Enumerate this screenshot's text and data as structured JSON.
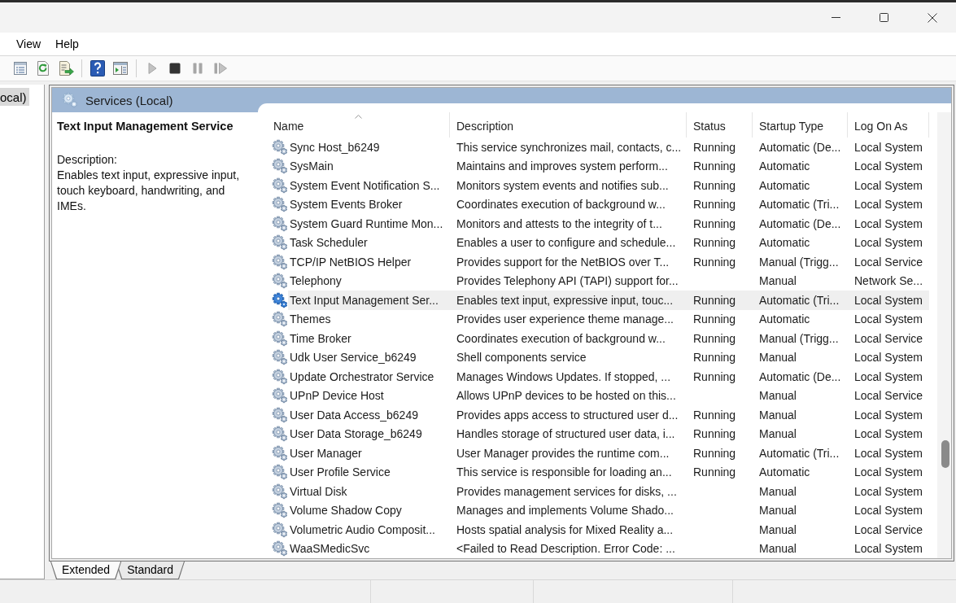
{
  "menu_bar": [
    {
      "label": "View"
    },
    {
      "label": "Help"
    }
  ],
  "toolbar": {
    "groups": [
      [
        {
          "kind": "properties",
          "disabled": false
        },
        {
          "kind": "refresh",
          "disabled": false
        },
        {
          "kind": "export",
          "disabled": false
        }
      ],
      [
        {
          "kind": "help",
          "disabled": false
        },
        {
          "kind": "console_tree",
          "disabled": false
        }
      ],
      [
        {
          "kind": "start",
          "disabled": true
        },
        {
          "kind": "stop",
          "disabled": false
        },
        {
          "kind": "pause",
          "disabled": true
        },
        {
          "kind": "restart",
          "disabled": true
        }
      ]
    ]
  },
  "tree": {
    "items": [
      {
        "label": "ocal)",
        "selected": true
      }
    ]
  },
  "panel": {
    "title": "Services (Local)"
  },
  "details": {
    "title": "Text Input Management Service",
    "description_label": "Description:",
    "description": "Enables text input, expressive input, touch keyboard, handwriting, and IMEs."
  },
  "table": {
    "columns": [
      {
        "label": "Name",
        "sorted": true
      },
      {
        "label": "Description",
        "sorted": false
      },
      {
        "label": "Status",
        "sorted": false
      },
      {
        "label": "Startup Type",
        "sorted": false
      },
      {
        "label": "Log On As",
        "sorted": false
      }
    ],
    "rows": [
      {
        "name": "Sync Host_b6249",
        "description": "This service synchronizes mail, contacts, c...",
        "status": "Running",
        "startup_type": "Automatic (De...",
        "log_on_as": "Local System",
        "selected": false
      },
      {
        "name": "SysMain",
        "description": "Maintains and improves system perform...",
        "status": "Running",
        "startup_type": "Automatic",
        "log_on_as": "Local System",
        "selected": false
      },
      {
        "name": "System Event Notification S...",
        "description": "Monitors system events and notifies sub...",
        "status": "Running",
        "startup_type": "Automatic",
        "log_on_as": "Local System",
        "selected": false
      },
      {
        "name": "System Events Broker",
        "description": "Coordinates execution of background w...",
        "status": "Running",
        "startup_type": "Automatic (Tri...",
        "log_on_as": "Local System",
        "selected": false
      },
      {
        "name": "System Guard Runtime Mon...",
        "description": "Monitors and attests to the integrity of t...",
        "status": "Running",
        "startup_type": "Automatic (De...",
        "log_on_as": "Local System",
        "selected": false
      },
      {
        "name": "Task Scheduler",
        "description": "Enables a user to configure and schedule...",
        "status": "Running",
        "startup_type": "Automatic",
        "log_on_as": "Local System",
        "selected": false
      },
      {
        "name": "TCP/IP NetBIOS Helper",
        "description": "Provides support for the NetBIOS over T...",
        "status": "Running",
        "startup_type": "Manual (Trigg...",
        "log_on_as": "Local Service",
        "selected": false
      },
      {
        "name": "Telephony",
        "description": "Provides Telephony API (TAPI) support for...",
        "startup_type": "Manual",
        "log_on_as": "Network Se...",
        "selected": false
      },
      {
        "name": "Text Input Management Ser...",
        "description": "Enables text input, expressive input, touc...",
        "status": "Running",
        "startup_type": "Automatic (Tri...",
        "log_on_as": "Local System",
        "selected": true
      },
      {
        "name": "Themes",
        "description": "Provides user experience theme manage...",
        "status": "Running",
        "startup_type": "Automatic",
        "log_on_as": "Local System",
        "selected": false
      },
      {
        "name": "Time Broker",
        "description": "Coordinates execution of background w...",
        "status": "Running",
        "startup_type": "Manual (Trigg...",
        "log_on_as": "Local Service",
        "selected": false
      },
      {
        "name": "Udk User Service_b6249",
        "description": "Shell components service",
        "status": "Running",
        "startup_type": "Manual",
        "log_on_as": "Local System",
        "selected": false
      },
      {
        "name": "Update Orchestrator Service",
        "description": "Manages Windows Updates. If stopped, ...",
        "status": "Running",
        "startup_type": "Automatic (De...",
        "log_on_as": "Local System",
        "selected": false
      },
      {
        "name": "UPnP Device Host",
        "description": "Allows UPnP devices to be hosted on this...",
        "startup_type": "Manual",
        "log_on_as": "Local Service",
        "selected": false
      },
      {
        "name": "User Data Access_b6249",
        "description": "Provides apps access to structured user d...",
        "status": "Running",
        "startup_type": "Manual",
        "log_on_as": "Local System",
        "selected": false
      },
      {
        "name": "User Data Storage_b6249",
        "description": "Handles storage of structured user data, i...",
        "status": "Running",
        "startup_type": "Manual",
        "log_on_as": "Local System",
        "selected": false
      },
      {
        "name": "User Manager",
        "description": "User Manager provides the runtime com...",
        "status": "Running",
        "startup_type": "Automatic (Tri...",
        "log_on_as": "Local System",
        "selected": false
      },
      {
        "name": "User Profile Service",
        "description": "This service is responsible for loading an...",
        "status": "Running",
        "startup_type": "Automatic",
        "log_on_as": "Local System",
        "selected": false
      },
      {
        "name": "Virtual Disk",
        "description": "Provides management services for disks, ...",
        "startup_type": "Manual",
        "log_on_as": "Local System",
        "selected": false
      },
      {
        "name": "Volume Shadow Copy",
        "description": "Manages and implements Volume Shado...",
        "startup_type": "Manual",
        "log_on_as": "Local System",
        "selected": false
      },
      {
        "name": "Volumetric Audio Composit...",
        "description": "Hosts spatial analysis for Mixed Reality a...",
        "startup_type": "Manual",
        "log_on_as": "Local Service",
        "selected": false
      },
      {
        "name": "WaaSMedicSvc",
        "description": "<Failed to Read Description. Error Code: ...",
        "startup_type": "Manual",
        "log_on_as": "Local System",
        "selected": false
      }
    ]
  },
  "view_tabs": [
    {
      "label": "Extended",
      "selected": true
    },
    {
      "label": "Standard",
      "selected": false
    }
  ]
}
